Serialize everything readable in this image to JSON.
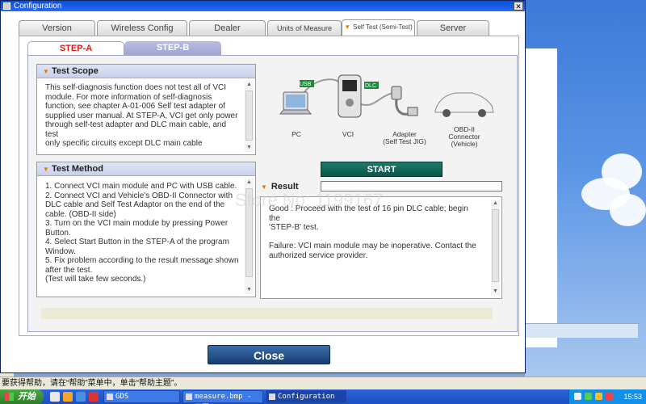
{
  "window": {
    "title": "Configuration",
    "close_glyph": "✕"
  },
  "tabs": [
    {
      "label": "Version"
    },
    {
      "label": "Wireless Config"
    },
    {
      "label": "Dealer"
    },
    {
      "label": "Units of Measure"
    },
    {
      "label": "Self Test (Semi-Test)",
      "active": true
    },
    {
      "label": "Server"
    }
  ],
  "steps": {
    "a": "STEP-A",
    "b": "STEP-B",
    "active": "STEP-A"
  },
  "test_scope": {
    "title": "Test Scope",
    "text": "This self-diagnosis function does not test all of VCI\nmodule. For more information of self-diagnosis\nfunction, see chapter A-01-006 Self test adapter of\nsupplied user manual. At STEP-A, VCI get only power\nthrough self-test adapter and DLC main cable, and test\nonly specific circuits except DLC main cable"
  },
  "test_method": {
    "title": "Test Method",
    "text": "1. Connect VCI main module and PC with USB cable.\n2. Connect VCI and Vehicle's OBD-II Connector with\nDLC cable  and Self Test Adaptor on the end of the\ncable. (OBD-II side)\n3. Turn on the VCI main module by pressing Power\nButton.\n4. Select Start Button in the STEP-A of the program\nWindow.\n5. Fix problem according to the result message shown\nafter the test.\n(Test will take few seconds.)"
  },
  "diagram": {
    "usb_tag": "USB",
    "dlc_tag": "DLC",
    "pc": "PC",
    "vci": "VCI",
    "adapter": "Adapter\n(Self Test JIG)",
    "connector": "OBD-II\nConnector\n(Vehicle)"
  },
  "start_button": "START",
  "result": {
    "label": "Result",
    "field_value": "",
    "text": "Good : Proceed with the test of 16 pin DLC cable; begin the\n'STEP-B' test.\n\nFailure: VCI main module may be inoperative. Contact the\nauthorized service provider."
  },
  "close_button": "Close",
  "watermark": "Store No: 1199167",
  "statusbar": "要获得帮助，请在“帮助”菜单中，单击“帮助主题”。",
  "taskbar": {
    "start": "开始",
    "tasks": [
      "GDS",
      "measure.bmp - 画图",
      "Configuration"
    ],
    "clock": "15:53"
  },
  "colors": {
    "accent_orange": "#e07a00",
    "step_a_red": "#e01818",
    "start_green": "#0b5448",
    "close_blue": "#163f73",
    "title_blue": "#0a4fd8"
  }
}
